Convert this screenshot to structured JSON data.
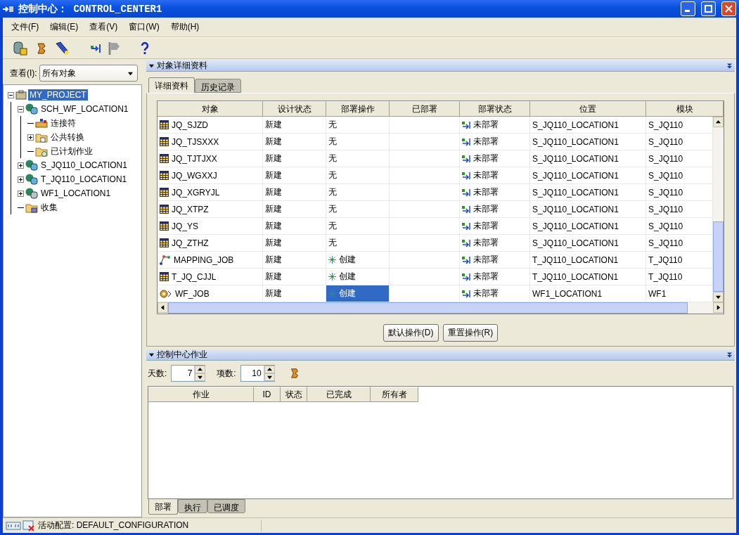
{
  "window": {
    "title": "控制中心： CONTROL_CENTER1"
  },
  "menu": [
    "文件(F)",
    "编辑(E)",
    "查看(V)",
    "窗口(W)",
    "帮助(H)"
  ],
  "view": {
    "label": "查看(I):",
    "value": "所有对象"
  },
  "tree": [
    {
      "kind": "project",
      "label": "MY_PROJECT",
      "expanded": true,
      "selected": true,
      "children": [
        {
          "kind": "location",
          "label": "SCH_WF_LOCATION1",
          "expanded": true,
          "selected": false,
          "children": [
            {
              "kind": "connector",
              "label": "连接符",
              "selected": false
            },
            {
              "kind": "folder",
              "label": "公共转换",
              "expanded": false,
              "selected": false
            },
            {
              "kind": "scheduled",
              "label": "已计划作业",
              "selected": false
            }
          ]
        },
        {
          "kind": "location",
          "label": "S_JQ110_LOCATION1",
          "expanded": false,
          "selected": false
        },
        {
          "kind": "location",
          "label": "T_JQ110_LOCATION1",
          "expanded": false,
          "selected": false
        },
        {
          "kind": "grey_location",
          "label": "WF1_LOCATION1",
          "expanded": false,
          "selected": false
        },
        {
          "kind": "collection",
          "label": "收集",
          "selected": false
        }
      ]
    }
  ],
  "details": {
    "title": "对象详细资料",
    "tabs": [
      {
        "label": "详细资料",
        "selected": true
      },
      {
        "label": "历史记录",
        "selected": false
      }
    ],
    "columns": [
      "对象",
      "设计状态",
      "部署操作",
      "已部署",
      "部署状态",
      "位置",
      "模块"
    ],
    "rows": [
      {
        "kind": "table",
        "object": "JQ_SJZD",
        "design": "新建",
        "action": "无",
        "action_icon": false,
        "status": "未部署",
        "location": "S_JQ110_LOCATION1",
        "module": "S_JQ110",
        "selected": false
      },
      {
        "kind": "table",
        "object": "JQ_TJSXXX",
        "design": "新建",
        "action": "无",
        "action_icon": false,
        "status": "未部署",
        "location": "S_JQ110_LOCATION1",
        "module": "S_JQ110",
        "selected": false
      },
      {
        "kind": "table",
        "object": "JQ_TJTJXX",
        "design": "新建",
        "action": "无",
        "action_icon": false,
        "status": "未部署",
        "location": "S_JQ110_LOCATION1",
        "module": "S_JQ110",
        "selected": false
      },
      {
        "kind": "table",
        "object": "JQ_WGXXJ",
        "design": "新建",
        "action": "无",
        "action_icon": false,
        "status": "未部署",
        "location": "S_JQ110_LOCATION1",
        "module": "S_JQ110",
        "selected": false
      },
      {
        "kind": "table",
        "object": "JQ_XGRYJL",
        "design": "新建",
        "action": "无",
        "action_icon": false,
        "status": "未部署",
        "location": "S_JQ110_LOCATION1",
        "module": "S_JQ110",
        "selected": false
      },
      {
        "kind": "table",
        "object": "JQ_XTPZ",
        "design": "新建",
        "action": "无",
        "action_icon": false,
        "status": "未部署",
        "location": "S_JQ110_LOCATION1",
        "module": "S_JQ110",
        "selected": false
      },
      {
        "kind": "table",
        "object": "JQ_YS",
        "design": "新建",
        "action": "无",
        "action_icon": false,
        "status": "未部署",
        "location": "S_JQ110_LOCATION1",
        "module": "S_JQ110",
        "selected": false
      },
      {
        "kind": "table",
        "object": "JQ_ZTHZ",
        "design": "新建",
        "action": "无",
        "action_icon": false,
        "status": "未部署",
        "location": "S_JQ110_LOCATION1",
        "module": "S_JQ110",
        "selected": false
      },
      {
        "kind": "mapping",
        "object": "MAPPING_JOB",
        "design": "新建",
        "action": "创建",
        "action_icon": true,
        "status": "未部署",
        "location": "T_JQ110_LOCATION1",
        "module": "T_JQ110",
        "selected": false
      },
      {
        "kind": "table",
        "object": "T_JQ_CJJL",
        "design": "新建",
        "action": "创建",
        "action_icon": true,
        "status": "未部署",
        "location": "T_JQ110_LOCATION1",
        "module": "T_JQ110",
        "selected": false
      },
      {
        "kind": "workflow",
        "object": "WF_JOB",
        "design": "新建",
        "action": "创建",
        "action_icon": true,
        "status": "未部署",
        "location": "WF1_LOCATION1",
        "module": "WF1",
        "selected": true
      }
    ],
    "buttons": [
      "默认操作(D)",
      "重置操作(R)"
    ]
  },
  "jobs": {
    "title": "控制中心作业",
    "days_label": "天数:",
    "days": "7",
    "items_label": "项数:",
    "items": "10",
    "columns": [
      "作业",
      "ID",
      "状态",
      "已完成",
      "所有者"
    ],
    "tabs": [
      {
        "label": "部署",
        "selected": true
      },
      {
        "label": "执行",
        "selected": false
      },
      {
        "label": "已调度",
        "selected": false
      }
    ]
  },
  "status_bar": "活动配置: DEFAULT_CONFIGURATION"
}
